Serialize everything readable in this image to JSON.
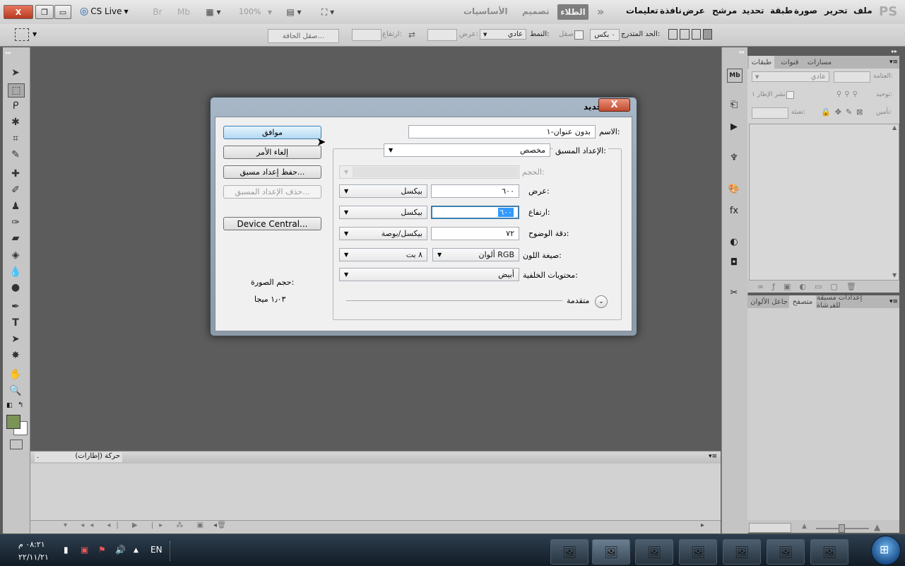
{
  "window_buttons": {
    "close": "X",
    "restore": "❐",
    "minimize": "▭"
  },
  "cslive": "CS Live",
  "app_logo": "PS",
  "menu": [
    "ملف",
    "تحرير",
    "صورة",
    "طبقة",
    "تحديد",
    "مرشح",
    "عرض",
    "نافذة",
    "تعليمات"
  ],
  "zoom": "100%",
  "bridge_label": "Br",
  "minibridge_label": "Mb",
  "workspaces": {
    "active": "الطلاء",
    "design": "تصميم",
    "essentials": "الأساسيات",
    "more": "»"
  },
  "options": {
    "feather_label": "الحد المتدرج:",
    "feather_value": "٠ بكس",
    "antialias": "صقل",
    "style_label": "النمط:",
    "style_value": "عادي",
    "width_label": "عرض:",
    "height_label": "ارتفاع:",
    "refine_edge": "صقل الحافة..."
  },
  "dialog": {
    "title": "جديد",
    "close": "X",
    "name_label": "الاسم:",
    "name_value": "بدون عنوان-١",
    "preset_label": "الإعداد المسبق:",
    "preset_value": "مخصص",
    "size_label": "الحجم:",
    "width_label": "عرض:",
    "width_value": "٦٠٠",
    "width_unit": "بيكسل",
    "height_label": "ارتفاع:",
    "height_value": "٦٠٠",
    "height_unit": "بيكسل",
    "resolution_label": "دقة الوضوح:",
    "resolution_value": "٧٢",
    "resolution_unit": "بيكسل/بوصة",
    "color_mode_label": "صيغة اللون:",
    "color_mode_value": "ألوان RGB",
    "bit_depth": "٨ بت",
    "background_label": "محتويات الخلفية:",
    "background_value": "أبيض",
    "advanced": "متقدمة",
    "ok": "موافق",
    "cancel": "إلغاء الأمر",
    "save_preset": "حفظ إعداد مسبق...",
    "delete_preset": "حذف الإعداد المسبق...",
    "device_central": "Device Central...",
    "image_size_label": "حجم الصورة:",
    "image_size_value": "١٫٠٣ ميجا"
  },
  "layers_panel": {
    "tabs": [
      "طبقات",
      "قنوات",
      "مسارات"
    ],
    "blend_mode": "عادي",
    "opacity_label": "العتامة:",
    "unify_label": "توحيد:",
    "propagate_label": "نشر الإطار ١",
    "lock_label": "تأمين:",
    "fill_label": "تعبئة:"
  },
  "bottom_panel_tabs": [
    "متصفح",
    "جاعل الألوان",
    "إعدادات مسبقة للفرشاة"
  ],
  "animation_panel": {
    "title": "حركة (إطارات)",
    "dot": "."
  },
  "taskbar": {
    "lang": "EN",
    "time": "٠٨:٢١ م",
    "date": "٢٢/١١/٢١"
  }
}
